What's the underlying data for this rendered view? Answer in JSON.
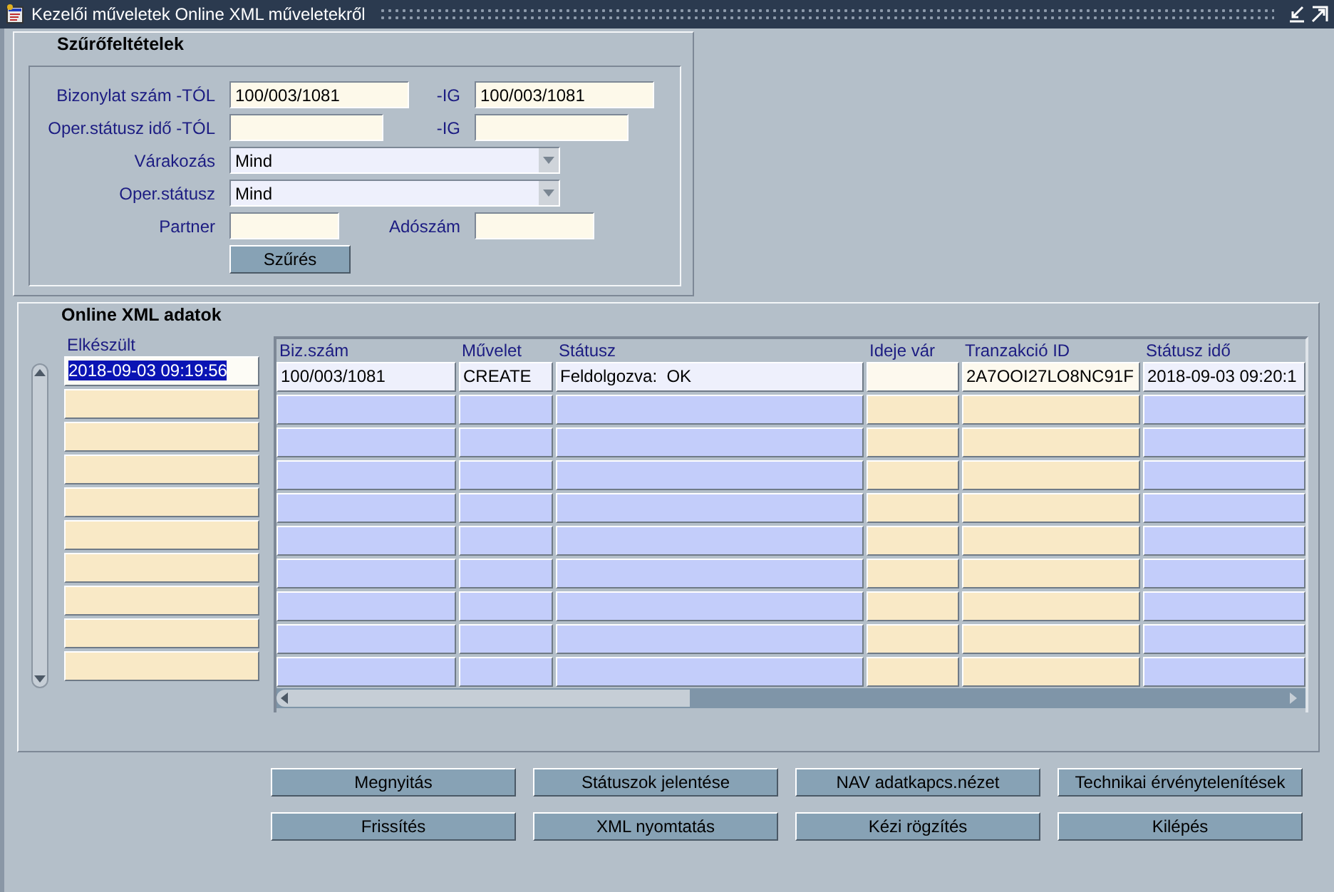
{
  "window": {
    "title": "Kezelői műveletek Online XML műveletekről"
  },
  "filter": {
    "title": "Szűrőfeltételek",
    "rows": [
      {
        "kind": "range",
        "label": "Bizonylat szám -TÓL",
        "value": "100/003/1081",
        "to_label": "-IG",
        "to_value": "100/003/1081"
      },
      {
        "kind": "range",
        "label": "Oper.státusz idő -TÓL",
        "to_label": "-IG"
      },
      {
        "kind": "dropdown",
        "label": "Várakozás",
        "value": "Mind"
      },
      {
        "kind": "dropdown",
        "label": "Oper.státusz",
        "value": "Mind"
      },
      {
        "kind": "pair",
        "label": "Partner",
        "to_label": "Adószám"
      },
      {
        "kind": "button",
        "label": "Szűrés"
      }
    ]
  },
  "data": {
    "title": "Online XML adatok",
    "left_column": {
      "label": "Elkészült"
    },
    "columns": [
      {
        "label": "Biz.szám",
        "kind": "display"
      },
      {
        "label": "Művelet",
        "kind": "display"
      },
      {
        "label": "Státusz",
        "kind": "display"
      },
      {
        "label": "Ideje vár",
        "kind": "entry"
      },
      {
        "label": "Tranzakció ID",
        "kind": "entry"
      },
      {
        "label": "Státusz idő",
        "kind": "display"
      }
    ],
    "rows": [
      {
        "selected": true,
        "elkeszult": "2018-09-03 09:19:56",
        "cells": [
          "100/003/1081",
          "CREATE",
          "Feldolgozva:  OK",
          null,
          "2A7OOI27LO8NC91F",
          "2018-09-03 09:20:1"
        ]
      },
      {
        "selected": false
      },
      {
        "selected": false
      },
      {
        "selected": false
      },
      {
        "selected": false
      },
      {
        "selected": false
      },
      {
        "selected": false
      },
      {
        "selected": false
      },
      {
        "selected": false
      },
      {
        "selected": false
      }
    ]
  },
  "buttons": [
    [
      "Megnyitás",
      "Státuszok jelentése",
      "NAV adatkapcs.nézet",
      "Technikai érvénytelenítések"
    ],
    [
      "Frissítés",
      "XML nyomtatás",
      "Kézi rögzítés",
      "Kilépés"
    ]
  ]
}
